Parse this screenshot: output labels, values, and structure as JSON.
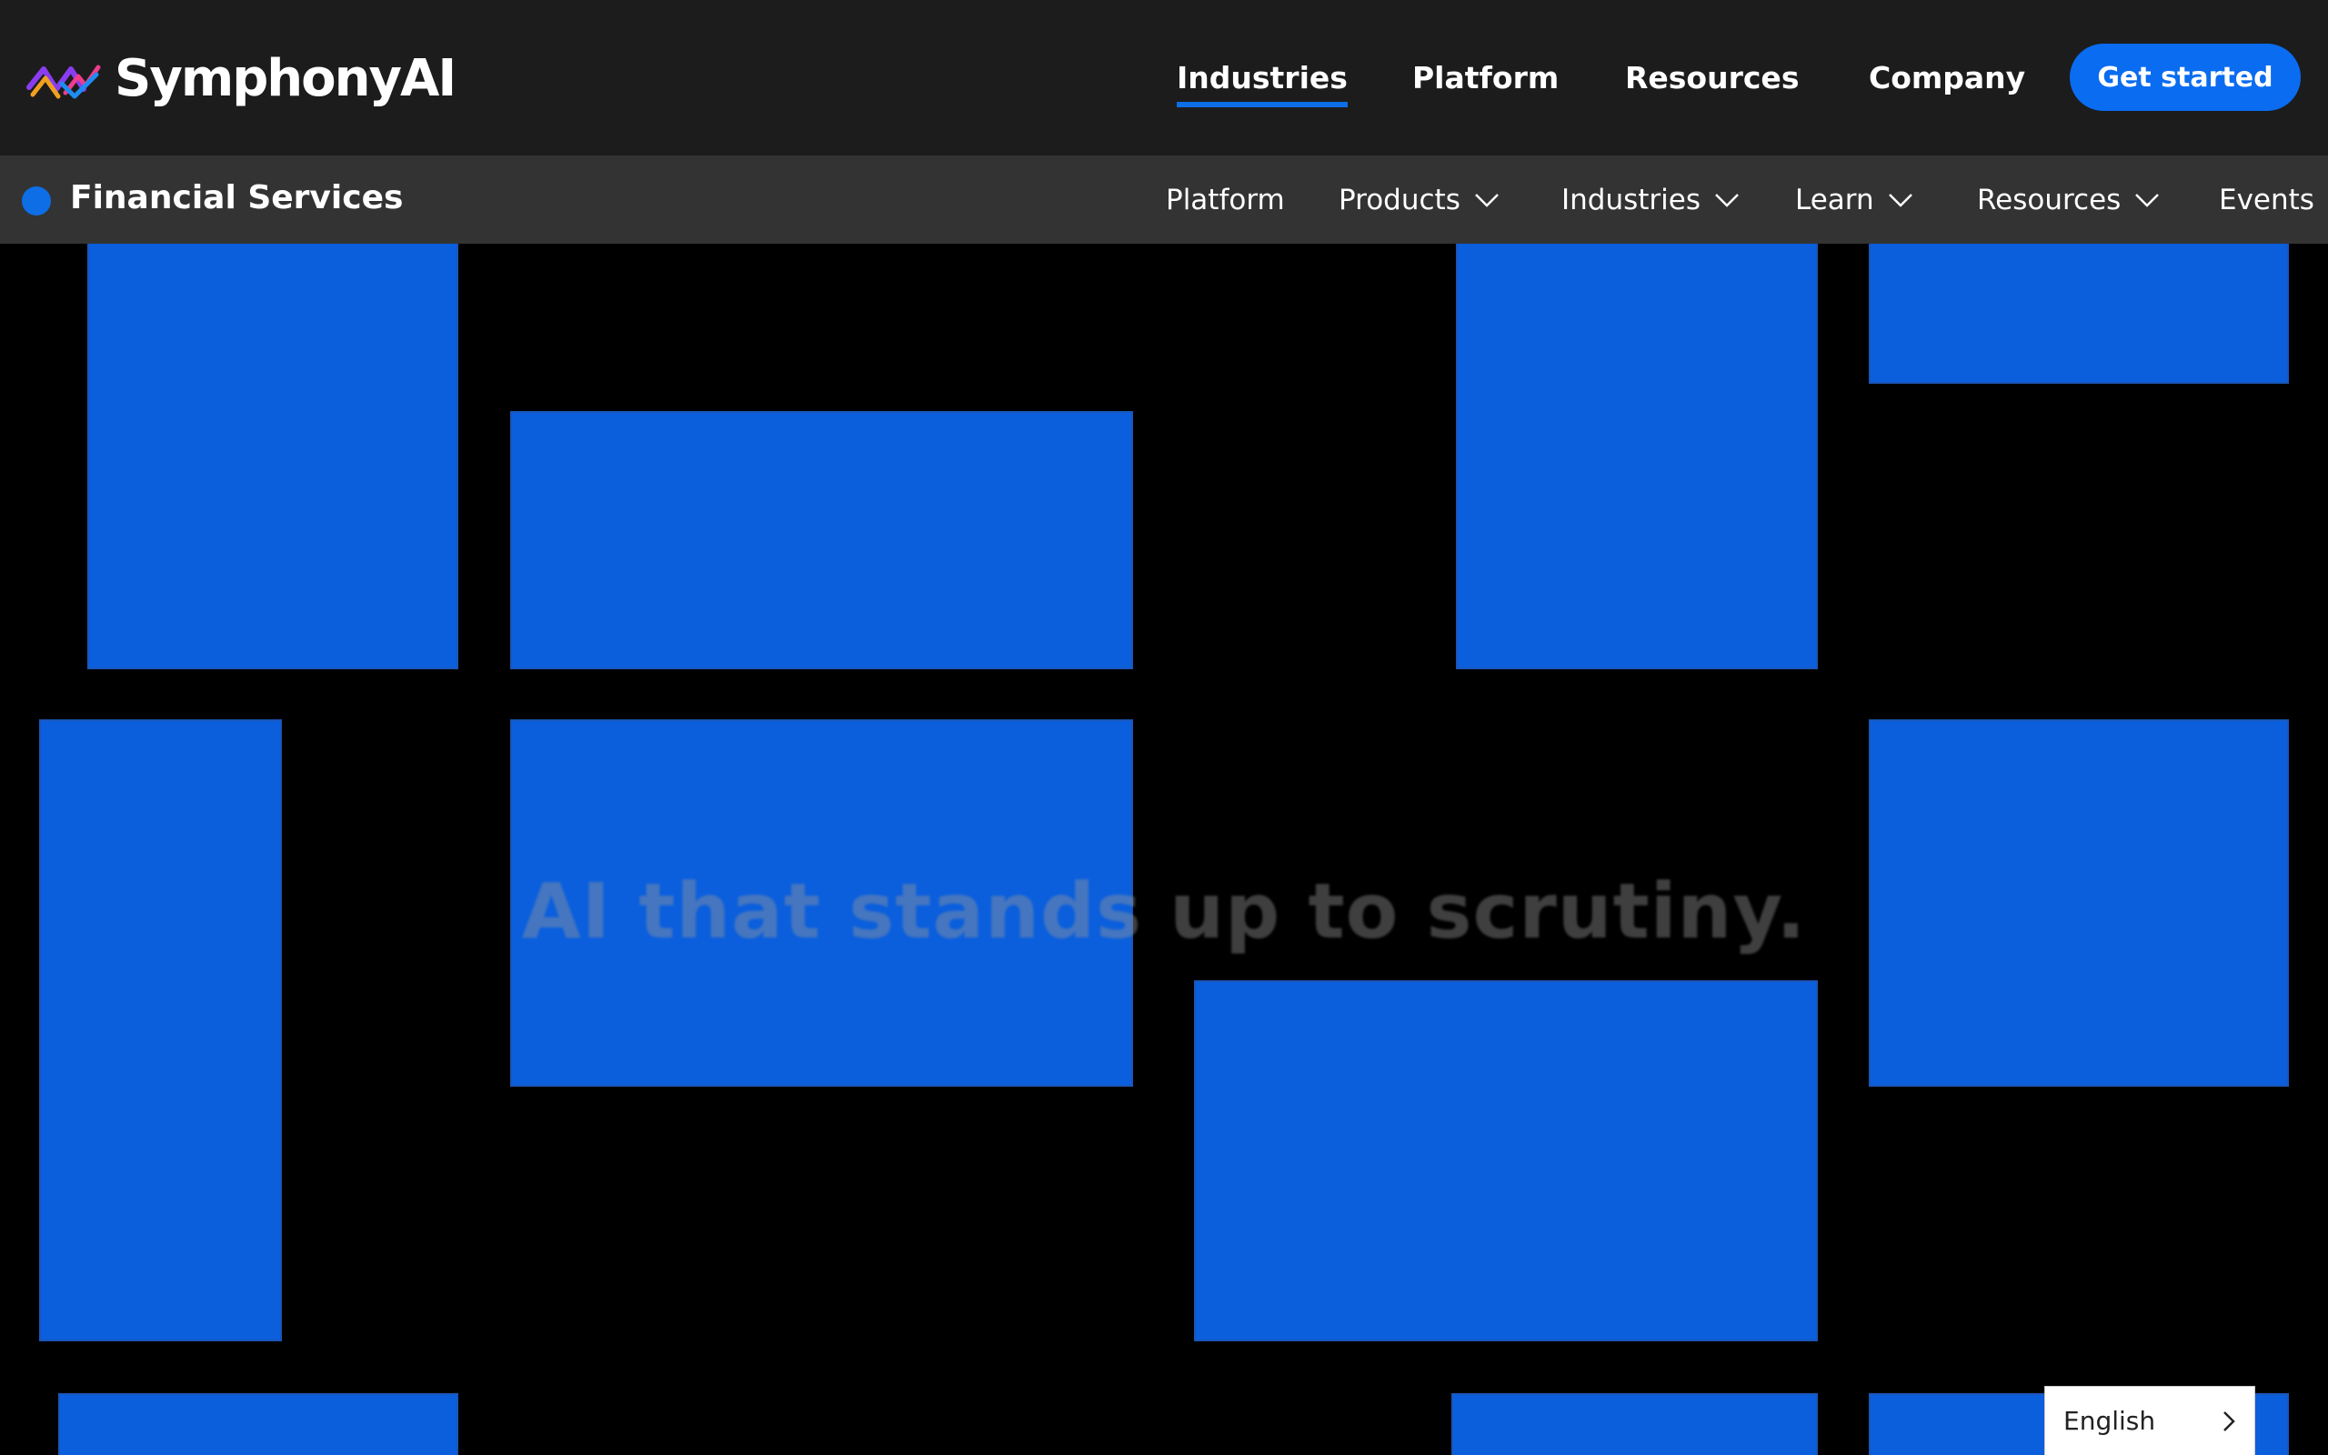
{
  "header": {
    "brand_name": "SymphonyAI",
    "nav": [
      {
        "label": "Industries",
        "active": true
      },
      {
        "label": "Platform",
        "active": false
      },
      {
        "label": "Resources",
        "active": false
      },
      {
        "label": "Company",
        "active": false
      }
    ],
    "cta_label": "Get started"
  },
  "subnav": {
    "section_title": "Financial Services",
    "items": [
      {
        "label": "Platform",
        "has_dropdown": false
      },
      {
        "label": "Products",
        "has_dropdown": true
      },
      {
        "label": "Industries",
        "has_dropdown": true
      },
      {
        "label": "Learn",
        "has_dropdown": true
      },
      {
        "label": "Resources",
        "has_dropdown": true
      },
      {
        "label": "Events",
        "has_dropdown": false
      }
    ]
  },
  "hero": {
    "headline": "AI that stands up to scrutiny."
  },
  "language_selector": {
    "label": "English",
    "icon": "chevron-right-icon"
  },
  "colors": {
    "top_bar": "#1c1c1c",
    "sub_bar": "#333333",
    "accent": "#0a6cf0",
    "tile": "#0b5fdd",
    "hero_background": "#000000"
  }
}
